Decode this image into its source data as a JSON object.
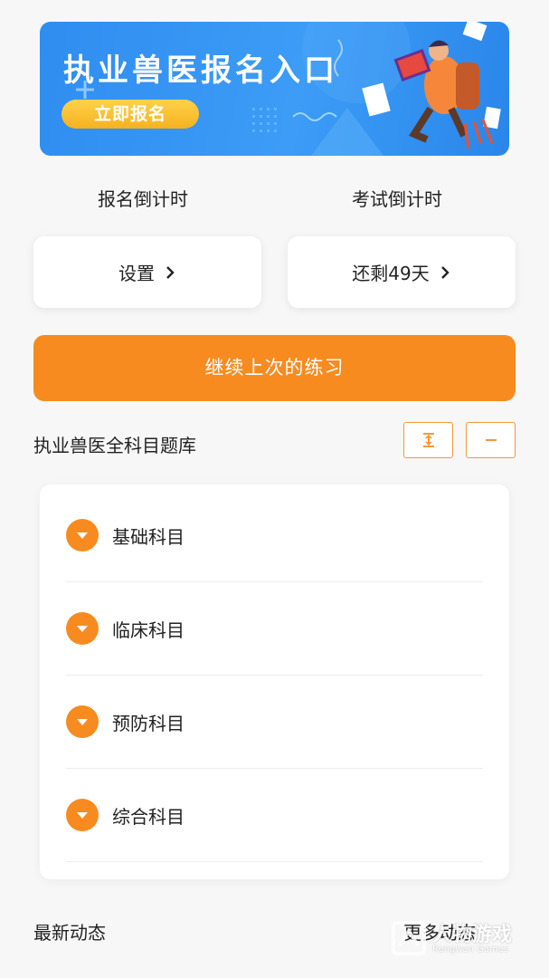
{
  "banner": {
    "title": "执业兽医报名入口",
    "button_label": "立即报名"
  },
  "countdown": {
    "signup_label": "报名倒计时",
    "exam_label": "考试倒计时",
    "signup_value": "设置",
    "exam_value": "还剩49天"
  },
  "continue_label": "继续上次的练习",
  "question_bank": {
    "title": "执业兽医全科目题库",
    "subjects": [
      {
        "label": "基础科目"
      },
      {
        "label": "临床科目"
      },
      {
        "label": "预防科目"
      },
      {
        "label": "综合科目"
      }
    ]
  },
  "news": {
    "title": "最新动态",
    "more_label": "更多动态"
  },
  "watermark": {
    "text": "人物游戏",
    "sub": "Rengwan Games"
  },
  "colors": {
    "accent": "#f78b20",
    "banner_blue": "#3c9cf6",
    "banner_button": "#f6b21f"
  }
}
